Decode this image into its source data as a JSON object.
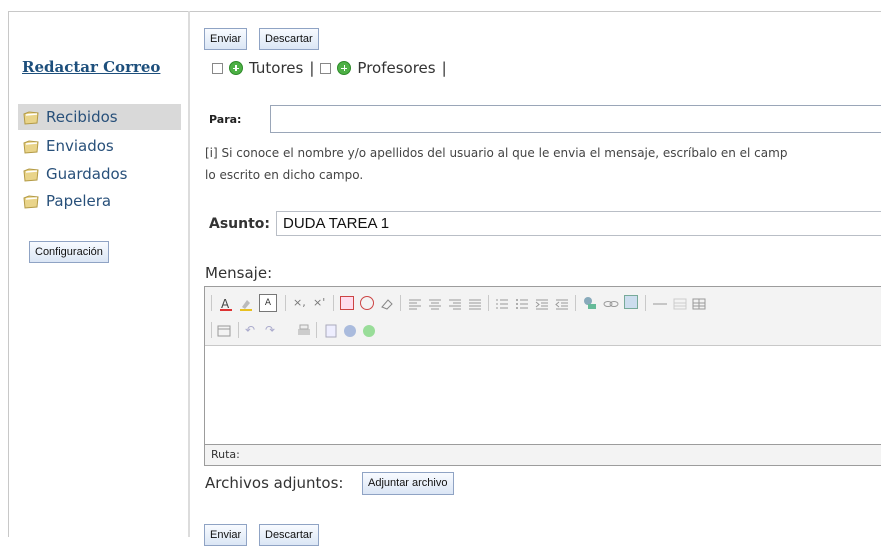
{
  "sidebar": {
    "title": "Redactar Correo",
    "folders": [
      {
        "label": "Recibidos",
        "icon": "folder-icon",
        "selected": true
      },
      {
        "label": "Enviados",
        "icon": "folder-icon",
        "selected": false
      },
      {
        "label": "Guardados",
        "icon": "folder-icon",
        "selected": false
      },
      {
        "label": "Papelera",
        "icon": "folder-icon",
        "selected": false
      }
    ],
    "config_label": "Configuración"
  },
  "actions": {
    "send_label": "Enviar",
    "discard_label": "Descartar"
  },
  "recipients": {
    "tutores_label": "Tutores",
    "profesores_label": "Profesores",
    "separator": "|"
  },
  "form": {
    "to_label": "Para:",
    "to_value": "",
    "hint_line1": "[i] Si conoce el nombre y/o apellidos del usuario al que le envia el mensaje, escríbalo en el camp",
    "hint_line2": "lo escrito en dicho campo.",
    "subject_label": "Asunto:",
    "subject_value": "DUDA TAREA 1",
    "message_label": "Mensaje:",
    "path_label": "Ruta:",
    "attachments_label": "Archivos adjuntos:",
    "attach_button": "Adjuntar archivo"
  },
  "toolbar_icons": [
    "font-color-icon",
    "highlight-icon",
    "font-size-icon",
    "subscript-icon",
    "superscript-icon",
    "paste-word-icon",
    "no-format-icon",
    "eraser-icon",
    "align-left-icon",
    "align-center-icon",
    "align-right-icon",
    "align-justify-icon",
    "ordered-list-icon",
    "unordered-list-icon",
    "indent-icon",
    "outdent-icon",
    "anchor-icon",
    "link-icon",
    "image-icon",
    "horizontal-rule-icon",
    "table-icon",
    "table-props-icon",
    "undo-icon",
    "redo-icon",
    "print-icon",
    "source-icon",
    "help-icon",
    "info-icon"
  ],
  "colors": {
    "link": "#1d4f7c",
    "selected_bg": "#d9d9d9",
    "button_border": "#8fa3c4",
    "green": "#4db045"
  }
}
